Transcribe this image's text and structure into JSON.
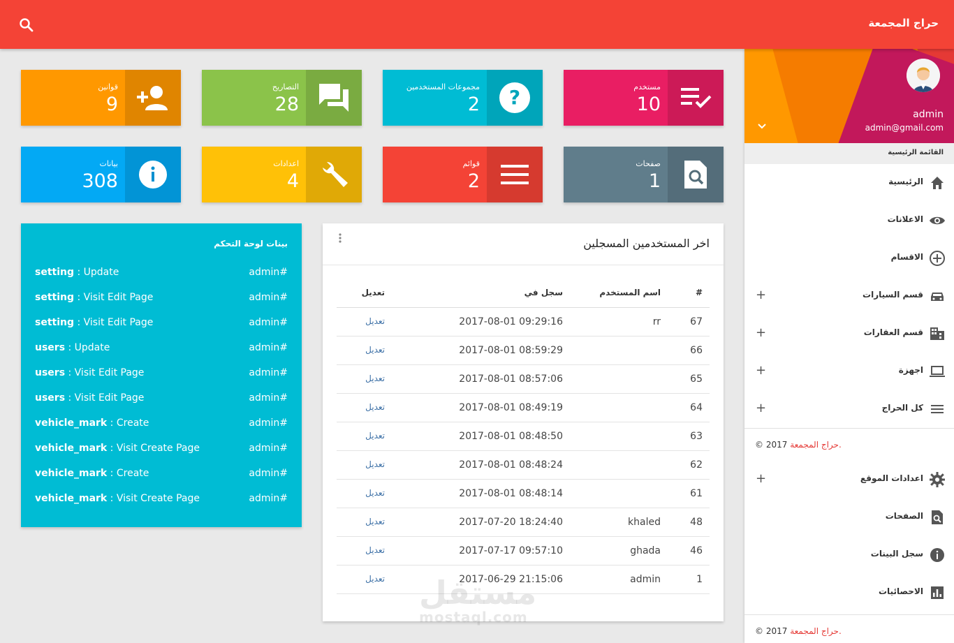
{
  "header": {
    "brand": "حراج المجمعة",
    "search_icon": "search-icon"
  },
  "colors": {
    "topbar": "#f44336",
    "log_card": "#00bcd4"
  },
  "stats": [
    {
      "label": "قوانين",
      "value": "9",
      "icon": "person-add-icon",
      "color": "#ff9800"
    },
    {
      "label": "التصاريح",
      "value": "28",
      "icon": "forum-icon",
      "color": "#8bc34a"
    },
    {
      "label": "مجموعات المستخدمين",
      "value": "2",
      "icon": "help-icon",
      "color": "#00bcd4"
    },
    {
      "label": "مستخدم",
      "value": "10",
      "icon": "playlist-check-icon",
      "color": "#e91e63"
    },
    {
      "label": "بيانات",
      "value": "308",
      "icon": "info-icon",
      "color": "#03a9f4"
    },
    {
      "label": "اعدادات",
      "value": "4",
      "icon": "wrench-icon",
      "color": "#ffc107"
    },
    {
      "label": "قوائم",
      "value": "2",
      "icon": "menu-icon",
      "color": "#f44336"
    },
    {
      "label": "صفحات",
      "value": "1",
      "icon": "find-in-page-icon",
      "color": "#607d8b"
    }
  ],
  "activity": {
    "title": "بينات لوحة التحكم",
    "rows": [
      {
        "module": "setting",
        "action": " : Update",
        "user": "admin#"
      },
      {
        "module": "setting",
        "action": " : Visit Edit Page",
        "user": "admin#"
      },
      {
        "module": "setting",
        "action": " : Visit Edit Page",
        "user": "admin#"
      },
      {
        "module": "users",
        "action": " : Update",
        "user": "admin#"
      },
      {
        "module": "users",
        "action": " : Visit Edit Page",
        "user": "admin#"
      },
      {
        "module": "users",
        "action": " : Visit Edit Page",
        "user": "admin#"
      },
      {
        "module": "vehicle_mark",
        "action": " : Create",
        "user": "admin#"
      },
      {
        "module": "vehicle_mark",
        "action": " : Visit Create Page",
        "user": "admin#"
      },
      {
        "module": "vehicle_mark",
        "action": " : Create",
        "user": "admin#"
      },
      {
        "module": "vehicle_mark",
        "action": " : Visit Create Page",
        "user": "admin#"
      }
    ]
  },
  "users_table": {
    "title": "اخر المستخدمين المسجلين",
    "columns": {
      "num": "#",
      "user": "اسم المستخدم",
      "date": "سجل في",
      "edit": "تعديل"
    },
    "rows": [
      {
        "num": "67",
        "user": "rr",
        "date": "2017-08-01 09:29:16",
        "edit": "تعديل"
      },
      {
        "num": "66",
        "user": "",
        "date": "2017-08-01 08:59:29",
        "edit": "تعديل"
      },
      {
        "num": "65",
        "user": "",
        "date": "2017-08-01 08:57:06",
        "edit": "تعديل"
      },
      {
        "num": "64",
        "user": "",
        "date": "2017-08-01 08:49:19",
        "edit": "تعديل"
      },
      {
        "num": "63",
        "user": "",
        "date": "2017-08-01 08:48:50",
        "edit": "تعديل"
      },
      {
        "num": "62",
        "user": "",
        "date": "2017-08-01 08:48:24",
        "edit": "تعديل"
      },
      {
        "num": "61",
        "user": "",
        "date": "2017-08-01 08:48:14",
        "edit": "تعديل"
      },
      {
        "num": "48",
        "user": "khaled",
        "date": "2017-07-20 18:24:40",
        "edit": "تعديل"
      },
      {
        "num": "46",
        "user": "ghada",
        "date": "2017-07-17 09:57:10",
        "edit": "تعديل"
      },
      {
        "num": "1",
        "user": "admin",
        "date": "2017-06-29 21:15:06",
        "edit": "تعديل"
      }
    ]
  },
  "sidebar": {
    "user_name": "admin",
    "user_email": "admin@gmail.com",
    "menu_head": "القائمة الرئيسية",
    "items": [
      {
        "label": "الرئيسية",
        "icon": "home-icon",
        "plus": ""
      },
      {
        "label": "الاعلانات",
        "icon": "eye-icon",
        "plus": ""
      },
      {
        "label": "الاقسام",
        "icon": "add-circle-icon",
        "plus": ""
      },
      {
        "label": "قسم السيارات",
        "icon": "car-icon",
        "plus": "+"
      },
      {
        "label": "قسم العقارات",
        "icon": "building-icon",
        "plus": "+"
      },
      {
        "label": "اجهزة",
        "icon": "laptop-icon",
        "plus": "+"
      },
      {
        "label": "كل الحراج",
        "icon": "list-icon",
        "plus": "+"
      }
    ],
    "copyright_mid": "© 2017",
    "copyright_mid_brand": "حراج المجمعة.",
    "items2": [
      {
        "label": "اعدادات الموقع",
        "icon": "gear-icon",
        "plus": "+"
      },
      {
        "label": "الصفحات",
        "icon": "find-in-page-icon",
        "plus": ""
      },
      {
        "label": "سجل البينات",
        "icon": "info-icon",
        "plus": ""
      },
      {
        "label": "الاحصائيات",
        "icon": "bar-chart-icon",
        "plus": ""
      }
    ],
    "copyright_bottom": "© 2017",
    "copyright_bottom_brand": "حراج المجمعة."
  },
  "watermark": {
    "arabic": "مستقل",
    "latin": "mostaql.com"
  }
}
